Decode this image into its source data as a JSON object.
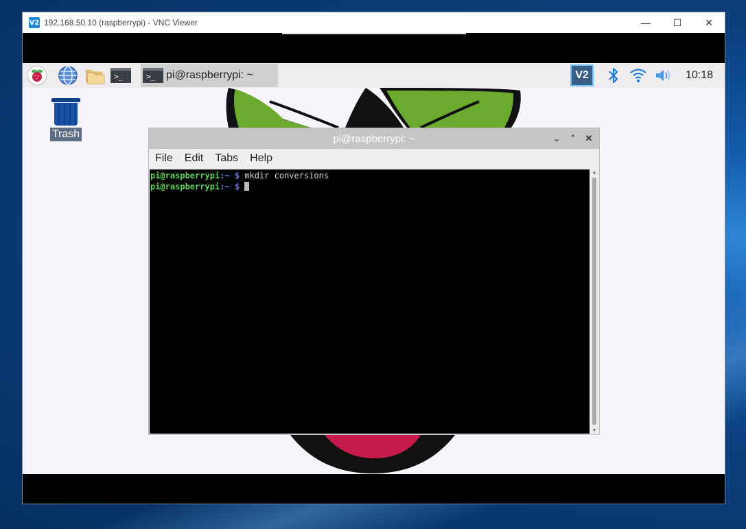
{
  "vnc": {
    "title": "192.168.50.10 (raspberrypi) - VNC Viewer",
    "logo_text": "V2",
    "min_glyph": "—",
    "max_glyph": "☐",
    "close_glyph": "✕"
  },
  "taskbar": {
    "task_label": "pi@raspberrypi: ~",
    "terminal_glyph": ">_",
    "vnc_text": "V2",
    "clock": "10:18"
  },
  "desktop": {
    "trash_label": "Trash"
  },
  "terminal": {
    "title": "pi@raspberrypi: ~",
    "min_glyph": "⌄",
    "max_glyph": "⌃",
    "close_glyph": "✕",
    "menu": [
      "File",
      "Edit",
      "Tabs",
      "Help"
    ],
    "lines": [
      {
        "user": "pi@raspberrypi",
        "path": ":~ $",
        "cmd": " mkdir conversions"
      },
      {
        "user": "pi@raspberrypi",
        "path": ":~ $",
        "cmd": " "
      }
    ]
  },
  "colors": {
    "prompt_user": "#5fd35f",
    "prompt_path": "#6b7df0",
    "vnc_accent": "#1f8ad8"
  }
}
